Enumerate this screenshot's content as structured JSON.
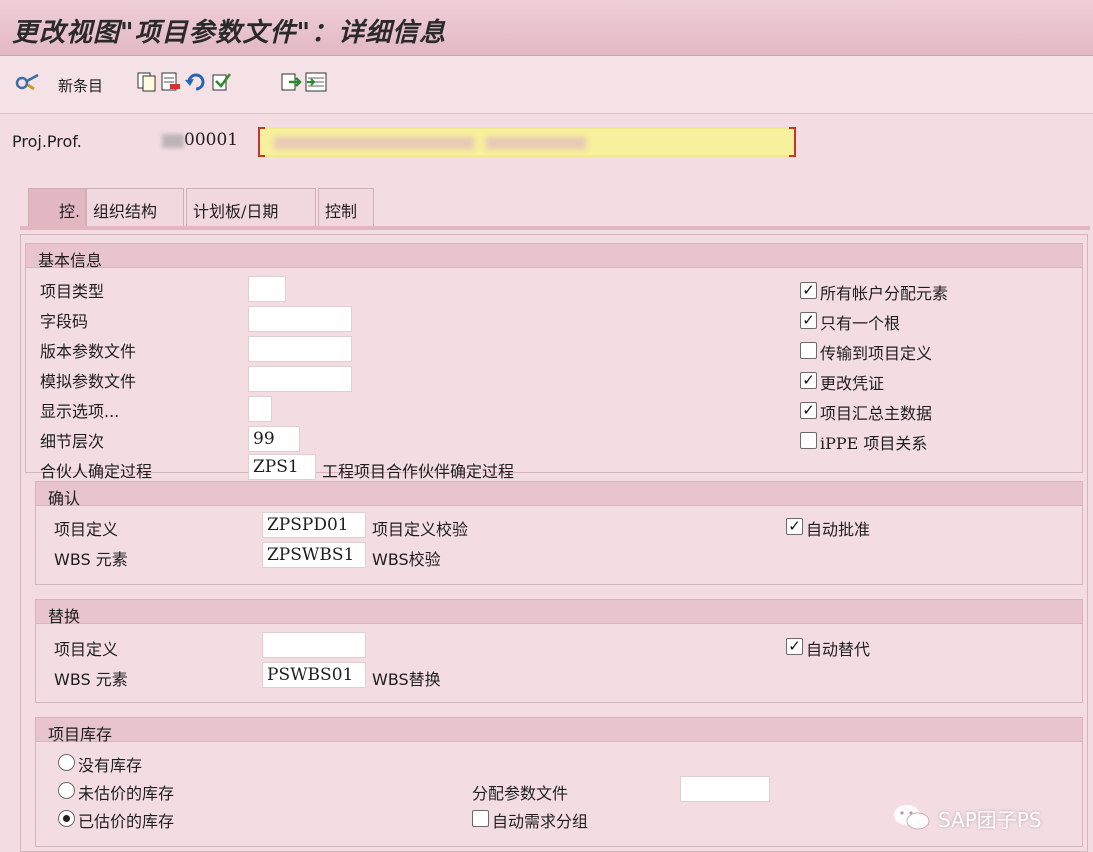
{
  "window": {
    "title": "更改视图\"项目参数文件\"：详细信息"
  },
  "toolbar": {
    "new_entries_label": "新条目"
  },
  "header": {
    "proj_prof_label": "Proj.Prof.",
    "proj_prof_value": "00001"
  },
  "tabs": [
    {
      "label": "控."
    },
    {
      "label": "组织结构"
    },
    {
      "label": "计划板/日期"
    },
    {
      "label": "控制"
    }
  ],
  "basic": {
    "title": "基本信息",
    "project_type_label": "项目类型",
    "project_type_value": "",
    "field_key_label": "字段码",
    "field_key_value": "",
    "version_profile_label": "版本参数文件",
    "version_profile_value": "",
    "simulation_profile_label": "模拟参数文件",
    "simulation_profile_value": "",
    "display_options_label": "显示选项...",
    "display_options_value": "",
    "level_of_detail_label": "细节层次",
    "level_of_detail_value": "99",
    "partner_proc_label": "合伙人确定过程",
    "partner_proc_value": "ZPS1",
    "partner_proc_desc": "工程项目合作伙伴确定过程",
    "checkboxes": [
      {
        "label": "所有帐户分配元素",
        "checked": true
      },
      {
        "label": "只有一个根",
        "checked": true
      },
      {
        "label": "传输到项目定义",
        "checked": false
      },
      {
        "label": "更改凭证",
        "checked": true
      },
      {
        "label": "项目汇总主数据",
        "checked": true
      },
      {
        "label": "iPPE 项目关系",
        "checked": false
      }
    ]
  },
  "validation": {
    "title": "确认",
    "project_def_label": "项目定义",
    "project_def_value": "ZPSPD01",
    "project_def_desc": "项目定义校验",
    "wbs_label": "WBS 元素",
    "wbs_value": "ZPSWBS1",
    "wbs_desc": "WBS校验",
    "auto_label": "自动批准",
    "auto_checked": true
  },
  "substitution": {
    "title": "替换",
    "project_def_label": "项目定义",
    "project_def_value": "",
    "wbs_label": "WBS 元素",
    "wbs_value": "PSWBS01",
    "wbs_desc": "WBS替换",
    "auto_label": "自动替代",
    "auto_checked": true
  },
  "stock": {
    "title": "项目库存",
    "options": [
      {
        "label": "没有库存",
        "selected": false
      },
      {
        "label": "未估价的库存",
        "selected": false
      },
      {
        "label": "已估价的库存",
        "selected": true
      }
    ],
    "alloc_profile_label": "分配参数文件",
    "alloc_profile_value": "",
    "auto_req_group_label": "自动需求分组",
    "auto_req_group_checked": false
  },
  "watermark": {
    "text": "SAP团子PS"
  },
  "icons": [
    "glasses-icon",
    "copy-icon",
    "delete-icon",
    "undo-icon",
    "select-all-icon",
    "deselect-icon",
    "block-select-icon",
    "wechat-icon"
  ]
}
